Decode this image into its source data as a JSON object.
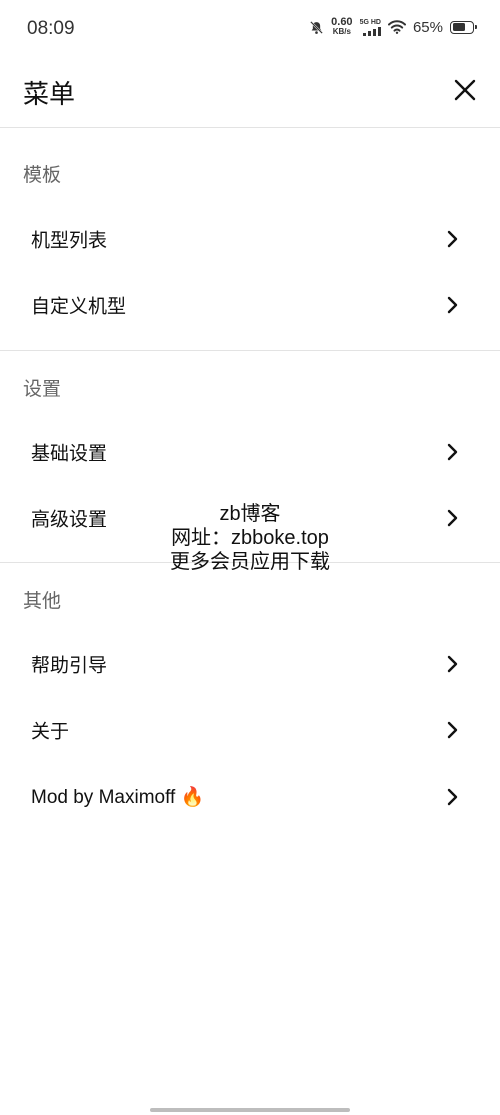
{
  "status_bar": {
    "time": "08:09",
    "net_speed_value": "0.60",
    "net_speed_unit": "KB/s",
    "signal_label": "5G HD",
    "battery_percent": "65%",
    "battery_level": 0.65
  },
  "header": {
    "title": "菜单"
  },
  "sections": [
    {
      "title": "模板",
      "items": [
        {
          "label": "机型列表"
        },
        {
          "label": "自定义机型"
        }
      ]
    },
    {
      "title": "设置",
      "items": [
        {
          "label": "基础设置"
        },
        {
          "label": "高级设置"
        }
      ]
    },
    {
      "title": "其他",
      "items": [
        {
          "label": "帮助引导"
        },
        {
          "label": "关于"
        },
        {
          "label": "Mod by Maximoff 🔥"
        }
      ]
    }
  ],
  "watermark": {
    "line1": "zb博客",
    "line2": "网址：zbboke.top",
    "line3": "更多会员应用下载"
  },
  "colors": {
    "divider": "#e3e3e3",
    "section_title": "#666666",
    "text": "#111111"
  }
}
